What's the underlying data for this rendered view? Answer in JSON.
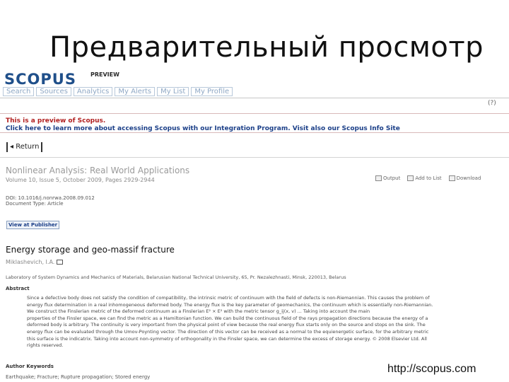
{
  "slide": {
    "title": "Предварительный просмотр",
    "footer_url": "http://scopus.com"
  },
  "header": {
    "logo": "SCOPUS",
    "preview_label": "PREVIEW",
    "nav": [
      "Search",
      "Sources",
      "Analytics",
      "My Alerts",
      "My List",
      "My Profile"
    ]
  },
  "notice": {
    "line1": "This is a preview of Scopus.",
    "line2": "Click here to learn more about accessing Scopus with our Integration Program. Visit also our Scopus Info Site"
  },
  "return_label": "Return",
  "record": {
    "journal": "Nonlinear Analysis: Real World Applications",
    "volume": "Volume 10, Issue 5, October 2009, Pages 2929-2944",
    "doi": "DOI: 10.1016/j.nonrwa.2008.09.012",
    "doc_type": "Document Type: Article",
    "view_at_publisher": "View at Publisher",
    "tools": [
      "Output",
      "Add to List",
      "Download"
    ],
    "title": "Energy storage and geo-massif fracture",
    "author": "Miklashevich, I.A.",
    "affiliation": "Laboratory of System Dynamics and Mechanics of Materials, Belarusian National Technical University, 65, Pr. Nezalezhnasti, Minsk, 220013, Belarus",
    "abstract_heading": "Abstract",
    "abstract": [
      "Since a defective body does not satisfy the condition of compatibility, the intrinsic metric of continuum with the field of defects is non-Riemannian. This causes the problem of",
      "energy flux determination in a real inhomogeneous deformed body. The energy flux is the key parameter of geomechanics, the continuum which is essentially non-Riemannian.",
      "We construct the Finslerian metric of the deformed continuum as a Finslerian E² × E² with the metric tensor g_ij(x, v) ... Taking into account the main",
      "properties of the Finsler space, we can find the metric as a Hamiltonian function. We can build the continuous field of the rays propagation directions because the energy of a",
      "deformed body is arbitrary. The continuity is very important from the physical point of view because the real energy flux starts only on the source and stops on the sink. The",
      "energy flux can be evaluated through the Umov-Poynting vector. The direction of this vector can be received as a normal to the equienergetic surface, for the arbitrary metric",
      "this surface is the indicatrix. Taking into account non-symmetry of orthogonality in the Finsler space, we can determine the excess of storage energy. © 2008 Elsevier Ltd. All",
      "rights reserved."
    ],
    "keywords_heading": "Author Keywords",
    "keywords": "Earthquake; Fracture; Rupture propagation; Stored energy"
  }
}
